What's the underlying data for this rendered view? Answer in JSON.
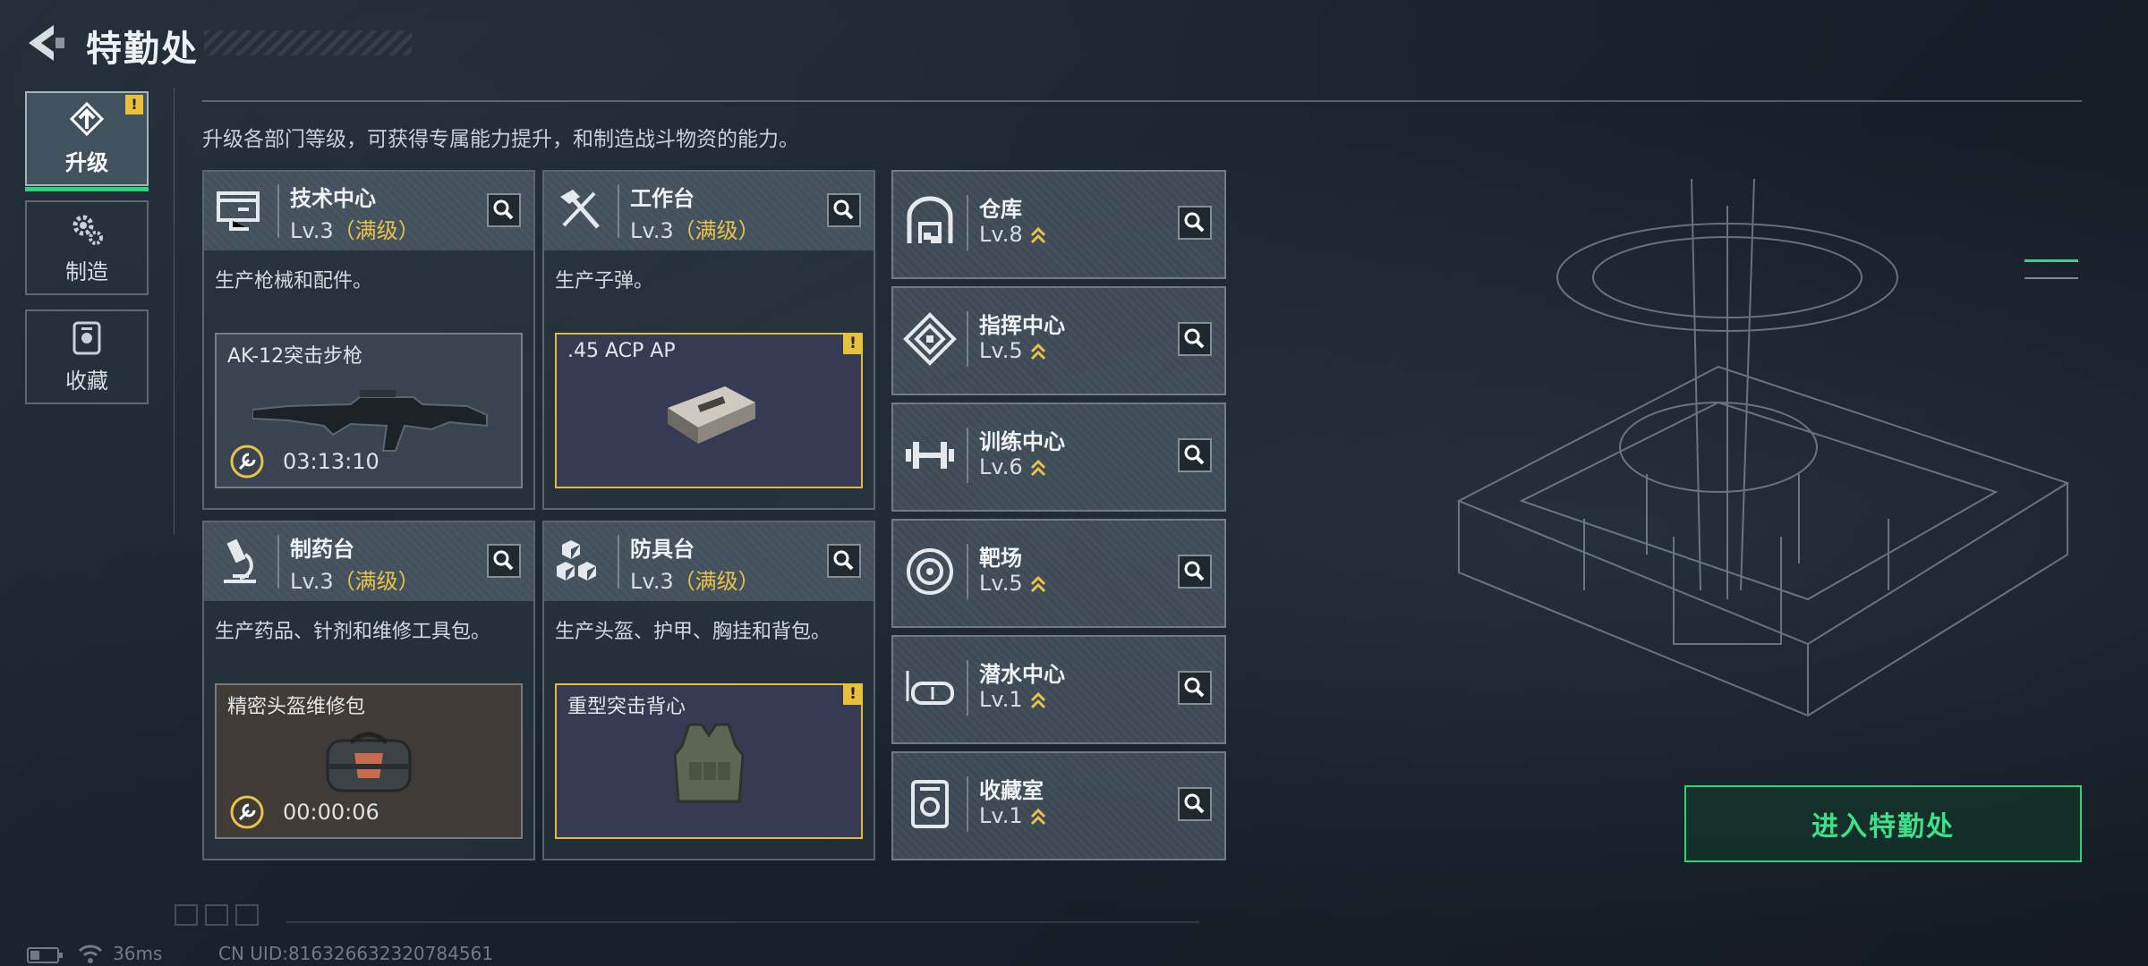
{
  "header": {
    "title": "特勤处",
    "back_icon": "back-arrow-icon"
  },
  "nav": {
    "items": [
      {
        "label": "升级",
        "icon": "upgrade-icon",
        "active": true,
        "badge": "!"
      },
      {
        "label": "制造",
        "icon": "gear-icon",
        "active": false
      },
      {
        "label": "收藏",
        "icon": "collection-icon",
        "active": false
      }
    ]
  },
  "description": "升级各部门等级，可获得专属能力提升，和制造战斗物资的能力。",
  "workstations": [
    {
      "name": "技术中心",
      "level": "Lv.3",
      "max_label": "（满级）",
      "desc": "生产枪械和配件。",
      "item": {
        "name": "AK-12突击步枪",
        "timer": "03:13:10",
        "style": "steel"
      }
    },
    {
      "name": "工作台",
      "level": "Lv.3",
      "max_label": "（满级）",
      "desc": "生产子弹。",
      "item": {
        "name": ".45 ACP AP",
        "style": "purple",
        "badge": "!"
      }
    },
    {
      "name": "制药台",
      "level": "Lv.3",
      "max_label": "（满级）",
      "desc": "生产药品、针剂和维修工具包。",
      "item": {
        "name": "精密头盔维修包",
        "timer": "00:00:06",
        "style": "brown"
      }
    },
    {
      "name": "防具台",
      "level": "Lv.3",
      "max_label": "（满级）",
      "desc": "生产头盔、护甲、胸挂和背包。",
      "item": {
        "name": "重型突击背心",
        "style": "purple",
        "badge": "!"
      }
    }
  ],
  "facilities": [
    {
      "name": "仓库",
      "level": "Lv.8",
      "icon": "warehouse-icon"
    },
    {
      "name": "指挥中心",
      "level": "Lv.5",
      "icon": "command-center-icon"
    },
    {
      "name": "训练中心",
      "level": "Lv.6",
      "icon": "dumbbell-icon"
    },
    {
      "name": "靶场",
      "level": "Lv.5",
      "icon": "target-icon"
    },
    {
      "name": "潜水中心",
      "level": "Lv.1",
      "icon": "diving-mask-icon"
    },
    {
      "name": "收藏室",
      "level": "Lv.1",
      "icon": "collection-room-icon"
    }
  ],
  "enter_button": "进入特勤处",
  "status_bar": {
    "ping": "36ms",
    "uid": "CN UID:816326632320784561"
  },
  "colors": {
    "accent_green": "#2fd47a",
    "max_gold": "#e8c34a",
    "badge_yellow": "#e7c13c"
  }
}
